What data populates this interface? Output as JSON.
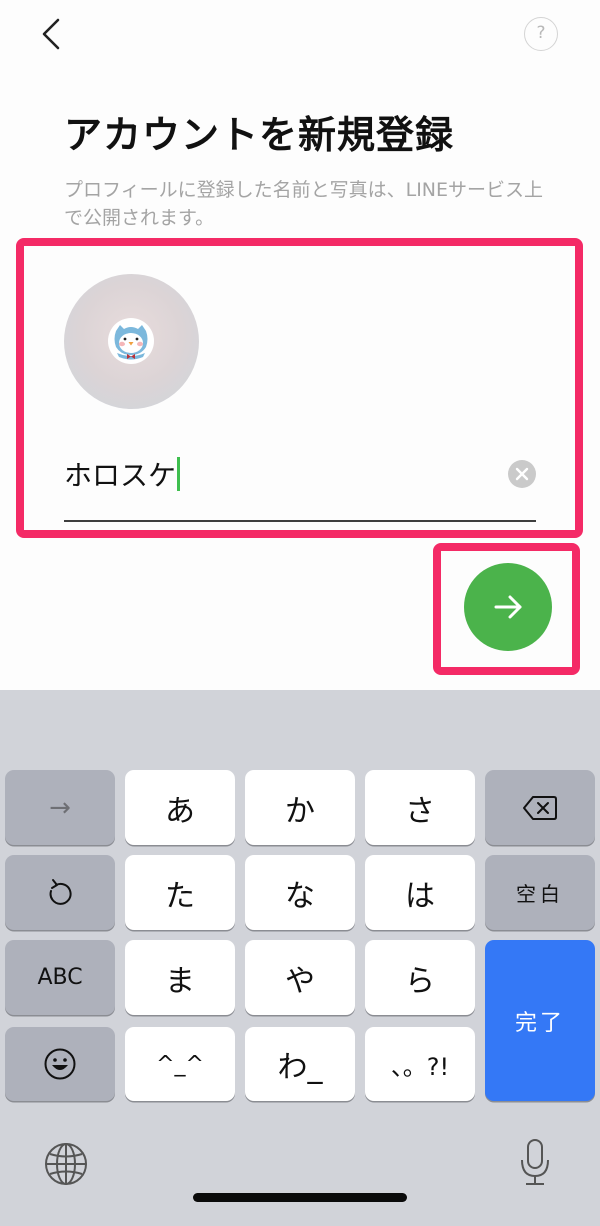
{
  "header": {
    "back_icon": "chevron-left-icon",
    "help_label": "?",
    "help_icon": "question-circle-icon"
  },
  "page": {
    "title": "アカウントを新規登録",
    "description": "プロフィールに登録した名前と写真は、LINEサービス上で公開されます。"
  },
  "profile": {
    "avatar_icon": "penguin-sticker-avatar",
    "name_value": "ホロスケ",
    "clear_icon": "clear-circle-icon"
  },
  "next_button": {
    "icon": "arrow-right-icon",
    "color": "#4bb34b"
  },
  "annotations": {
    "highlight_color": "#f42a66"
  },
  "keyboard": {
    "rows": [
      {
        "left": "→",
        "keys": [
          "あ",
          "か",
          "さ"
        ],
        "right_icon": "backspace-icon"
      },
      {
        "left_icon": "undo-icon",
        "keys": [
          "た",
          "な",
          "は"
        ],
        "right": "空白"
      },
      {
        "left": "ABC",
        "keys": [
          "ま",
          "や",
          "ら"
        ]
      },
      {
        "left_icon": "emoji-icon",
        "keys": [
          "^_^",
          "わ_",
          "、。?!"
        ]
      }
    ],
    "done_label": "完了",
    "done_color": "#3478f6",
    "globe_icon": "globe-icon",
    "mic_icon": "microphone-icon"
  }
}
